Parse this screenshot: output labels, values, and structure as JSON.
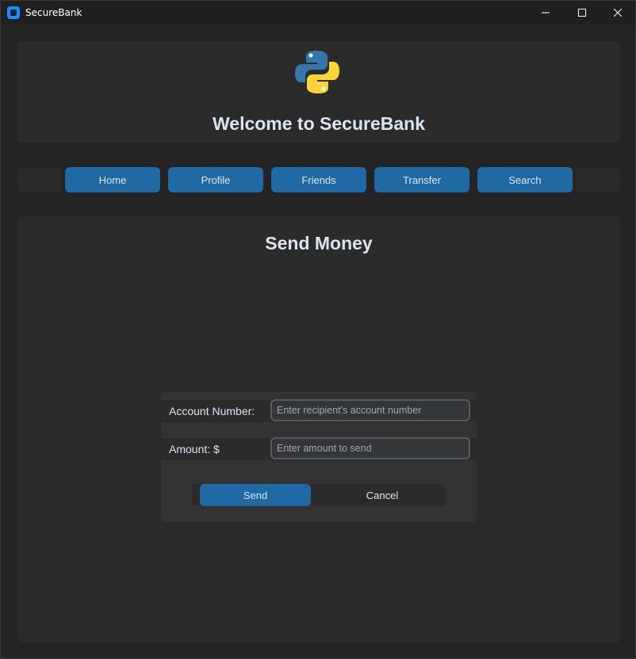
{
  "window": {
    "title": "SecureBank",
    "app_icon": "securebank-app-icon",
    "controls": [
      "minimize-icon",
      "maximize-icon",
      "close-icon"
    ]
  },
  "header": {
    "logo_icon": "python-logo-icon",
    "title": "Welcome to SecureBank"
  },
  "nav": {
    "items": [
      {
        "label": "Home"
      },
      {
        "label": "Profile"
      },
      {
        "label": "Friends"
      },
      {
        "label": "Transfer"
      },
      {
        "label": "Search"
      }
    ]
  },
  "main": {
    "title": "Send Money",
    "form": {
      "account": {
        "label": "Account Number:",
        "value": "",
        "placeholder": "Enter recipient's account number"
      },
      "amount": {
        "label": "Amount: $",
        "value": "",
        "placeholder": "Enter amount to send"
      },
      "send_label": "Send",
      "cancel_label": "Cancel"
    }
  },
  "colors": {
    "accent": "#1f6aa5",
    "background": "#242424",
    "panel": "#2b2b2b",
    "text": "#dce4ee"
  }
}
